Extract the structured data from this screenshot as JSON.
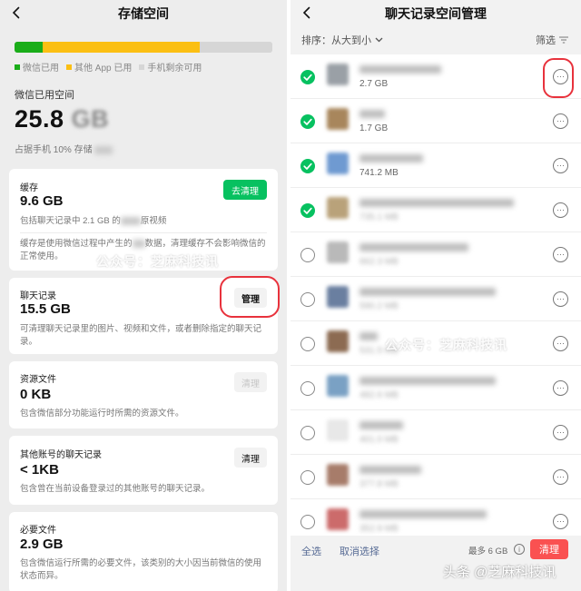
{
  "left": {
    "title": "存储空间",
    "usage_bar": [
      {
        "color": "#1aad19",
        "fraction": 0.11
      },
      {
        "color": "#fbbf13",
        "fraction": 0.61
      },
      {
        "color": "#d6d6d6",
        "fraction": 0.28
      }
    ],
    "legend": [
      {
        "label": "微信已用",
        "color": "#1aad19"
      },
      {
        "label": "其他 App 已用",
        "color": "#fbbf13"
      },
      {
        "label": "手机剩余可用",
        "color": "#d6d6d6"
      }
    ],
    "wechat_used_label": "微信已用空间",
    "wechat_used_size": "25.8",
    "wechat_used_unit": "GB",
    "wechat_used_pct": "占据手机 10% 存储",
    "cards": {
      "cache": {
        "title": "缓存",
        "size": "9.6 GB",
        "button": "去清理",
        "desc1": "包括聊天记录中 2.1 GB 的",
        "desc1_tail": "原视频",
        "desc2": "缓存是使用微信过程中产生的",
        "desc2_tail": "数据，清理缓存不会影响微信的正常使用。"
      },
      "chat": {
        "title": "聊天记录",
        "size": "15.5 GB",
        "button": "管理",
        "desc": "可清理聊天记录里的图片、视频和文件，或者删除指定的聊天记录。"
      },
      "resource": {
        "title": "资源文件",
        "size": "0 KB",
        "button": "清理",
        "desc": "包含微信部分功能运行时所需的资源文件。"
      },
      "other_accounts": {
        "title": "其他账号的聊天记录",
        "size": "< 1KB",
        "button": "清理",
        "desc": "包含曾在当前设备登录过的其他账号的聊天记录。"
      },
      "required": {
        "title": "必要文件",
        "size": "2.9 GB",
        "desc": "包含微信运行所需的必要文件，该类别的大小因当前微信的使用状态而异。"
      }
    },
    "watermark": "公众号：芝麻科技讯"
  },
  "right": {
    "title": "聊天记录空间管理",
    "sort_label": "排序：从大到小",
    "filter_label": "筛选",
    "rows": [
      {
        "checked": true,
        "size": "2.7 GB",
        "size_visible": true,
        "name_width": 90,
        "avatar": "#9aa0a6"
      },
      {
        "checked": true,
        "size": "1.7 GB",
        "size_visible": true,
        "name_width": 28,
        "avatar": "#a8865c"
      },
      {
        "checked": true,
        "size": "741.2 MB",
        "size_visible": true,
        "name_width": 70,
        "avatar": "#6f9ad1"
      },
      {
        "checked": true,
        "size": "735.1 MB",
        "size_visible": false,
        "name_width": 170,
        "avatar": "#b9a27a"
      },
      {
        "checked": false,
        "size": "662.3 MB",
        "size_visible": false,
        "name_width": 120,
        "avatar": "#b9b9b9"
      },
      {
        "checked": false,
        "size": "590.2 MB",
        "size_visible": false,
        "name_width": 150,
        "avatar": "#6a7fa0"
      },
      {
        "checked": false,
        "size": "531.5 MB",
        "size_visible": false,
        "name_width": 20,
        "avatar": "#8c6b52"
      },
      {
        "checked": false,
        "size": "482.6 MB",
        "size_visible": false,
        "name_width": 150,
        "avatar": "#7aa1c4"
      },
      {
        "checked": false,
        "size": "401.0 MB",
        "size_visible": false,
        "name_width": 48,
        "avatar": "#e8e8e8"
      },
      {
        "checked": false,
        "size": "377.8 MB",
        "size_visible": false,
        "name_width": 68,
        "avatar": "#a77c6a"
      },
      {
        "checked": false,
        "size": "352.9 MB",
        "size_visible": false,
        "name_width": 140,
        "avatar": "#cc6b6b"
      }
    ],
    "select_all": "全选",
    "cancel_select": "取消选择",
    "max_label": "最多 6 GB",
    "info_icon_text": "i",
    "clean_button": "清理",
    "watermark": "公众号：芝麻科技讯"
  },
  "footer_watermark": "头条 @芝麻科技讯"
}
